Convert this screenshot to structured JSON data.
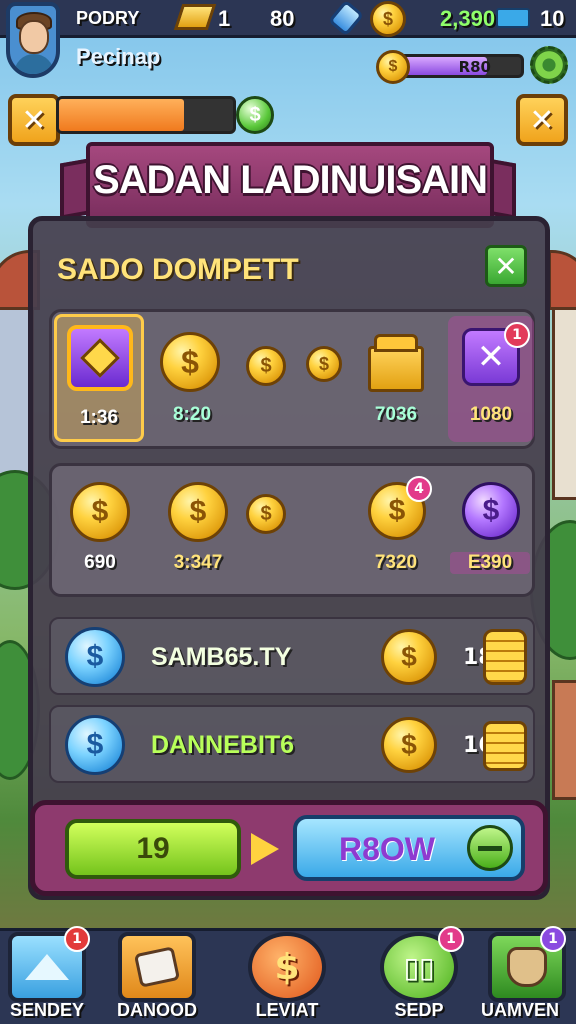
{
  "colors": {
    "accent": "#f07a1e",
    "panel": "#463e4e",
    "banner": "#8e3a6e",
    "nav": "#2c3654",
    "success": "#5ac83a"
  },
  "topbar": {
    "player_name": "PODRY",
    "player_sub": "Pecinap",
    "gold_count": "1",
    "score": "80",
    "coin_balance": "2,390",
    "level": "10",
    "energy_label": "R80"
  },
  "progress": {
    "fill": 0.72,
    "energy_fill": 0.72
  },
  "icons": {
    "avatar": "player-avatar-icon",
    "gold": "gold-bar-icon",
    "gem": "blue-gem-icon",
    "coin": "gold-coin-icon",
    "settings": "gear-icon",
    "close": "close-icon",
    "dollar": "dollar-icon"
  },
  "banner": {
    "title": "SADAN LADINUISAIN"
  },
  "panel": {
    "title": "SADO DOMPETT"
  },
  "row1": {
    "items": [
      {
        "label": "1:36",
        "icon": "purple-chest-icon",
        "selected": true
      },
      {
        "label": "8:20",
        "icon": "gold-coin-icon"
      },
      {
        "label": "",
        "icon": "gold-coin-icon"
      },
      {
        "label": "",
        "icon": "gold-coin-icon"
      },
      {
        "label": "7036",
        "icon": "treasure-box-icon"
      },
      {
        "label": "1080",
        "icon": "purple-x-icon",
        "badge": "1"
      }
    ]
  },
  "row2": {
    "items": [
      {
        "label": "690",
        "icon": "gold-coin-icon"
      },
      {
        "label": "3:347",
        "icon": "gold-coin-icon"
      },
      {
        "label": "",
        "icon": "gold-coin-icon"
      },
      {
        "label": "7320",
        "icon": "gold-coin-icon",
        "badge": "4"
      },
      {
        "label": "E390",
        "icon": "purple-coin-icon"
      }
    ]
  },
  "list": [
    {
      "name": "SAMB65.TY",
      "count": "18"
    },
    {
      "name": "DANNEBIT6",
      "count": "16"
    }
  ],
  "actions": {
    "amount": "19",
    "buy_label": "R8OW"
  },
  "nav": [
    {
      "label": "SENDEY",
      "badge": "1"
    },
    {
      "label": "DANOOD",
      "badge": ""
    },
    {
      "label": "LEVIAT",
      "badge": ""
    },
    {
      "label": "SEDP",
      "badge": "1"
    },
    {
      "label": "UAMVEN",
      "badge": "1"
    }
  ]
}
